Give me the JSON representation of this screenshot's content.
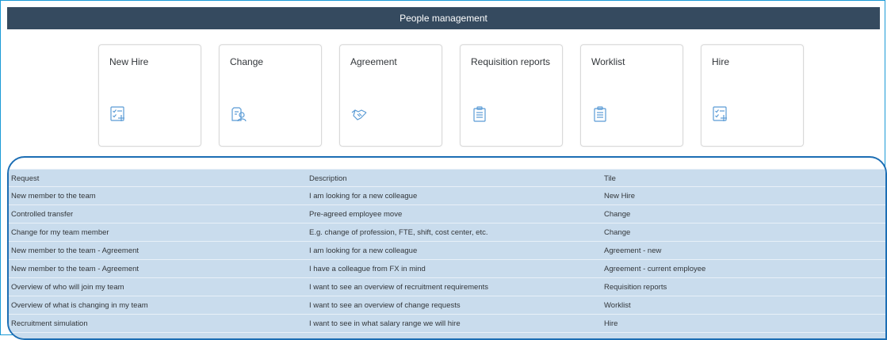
{
  "header": {
    "title": "People management"
  },
  "tiles": [
    {
      "label": "New Hire",
      "icon": "add-checklist-icon"
    },
    {
      "label": "Change",
      "icon": "employee-lookup-icon"
    },
    {
      "label": "Agreement",
      "icon": "handshake-icon"
    },
    {
      "label": "Requisition reports",
      "icon": "clipboard-icon"
    },
    {
      "label": "Worklist",
      "icon": "clipboard-icon"
    },
    {
      "label": "Hire",
      "icon": "add-checklist-icon"
    }
  ],
  "table": {
    "columns": [
      "Request",
      "Description",
      "Tile"
    ],
    "rows": [
      [
        "New member to the team",
        "I am looking for a new colleague",
        "New Hire"
      ],
      [
        "Controlled transfer",
        "Pre-agreed employee move",
        "Change"
      ],
      [
        "Change for my team member",
        "E.g. change of profession, FTE, shift, cost center, etc.",
        "Change"
      ],
      [
        "New member to the team - Agreement",
        "I am looking for a new colleague",
        "Agreement - new"
      ],
      [
        "New member to the team - Agreement",
        "I have a colleague from FX in mind",
        "Agreement - current employee"
      ],
      [
        "Overview of who will join my team",
        "I want to see an overview of recruitment requirements",
        "Requisition reports"
      ],
      [
        "Overview of what is changing in my team",
        "I want to see an overview of change requests",
        "Worklist"
      ],
      [
        "Recruitment simulation",
        "I want to see in what salary range we will hire",
        "Hire"
      ]
    ]
  },
  "colors": {
    "header_bg": "#354a5f",
    "accent": "#1c6eb4",
    "table_bg": "#c9dced",
    "icon": "#5a9bd5"
  }
}
